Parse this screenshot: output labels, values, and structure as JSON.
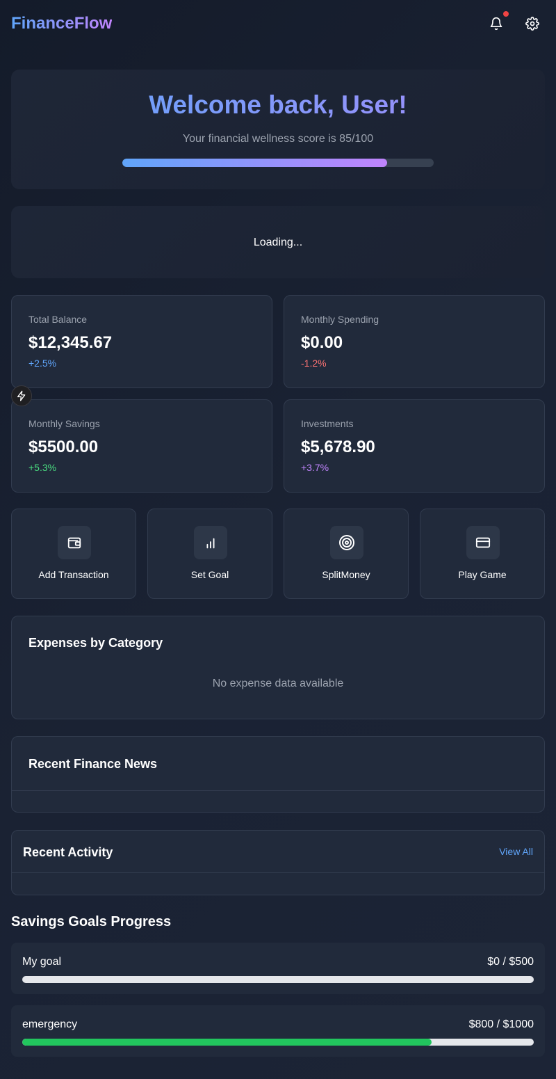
{
  "header": {
    "logo": "FinanceFlow",
    "icons": [
      "bell-icon",
      "gear-icon"
    ],
    "notification_dot_color": "#ef4444"
  },
  "welcome": {
    "title": "Welcome back, User!",
    "subtitle": "Your financial wellness score is 85/100",
    "score": 85,
    "score_max": 100
  },
  "loading": {
    "text": "Loading..."
  },
  "stats": [
    {
      "label": "Total Balance",
      "value": "$12,345.67",
      "change": "+2.5%",
      "change_color": "#60a5fa"
    },
    {
      "label": "Monthly Spending",
      "value": "$0.00",
      "change": "-1.2%",
      "change_color": "#f87171"
    },
    {
      "label": "Monthly Savings",
      "value": "$5500.00",
      "change": "+5.3%",
      "change_color": "#4ade80"
    },
    {
      "label": "Investments",
      "value": "$5,678.90",
      "change": "+3.7%",
      "change_color": "#c084fc"
    }
  ],
  "actions": [
    {
      "label": "Add Transaction",
      "icon": "wallet-icon"
    },
    {
      "label": "Set Goal",
      "icon": "bar-chart-icon"
    },
    {
      "label": "SplitMoney",
      "icon": "target-icon"
    },
    {
      "label": "Play Game",
      "icon": "credit-card-icon"
    }
  ],
  "expenses": {
    "title": "Expenses by Category",
    "empty_text": "No expense data available"
  },
  "news": {
    "title": "Recent Finance News"
  },
  "activity": {
    "title": "Recent Activity",
    "view_all": "View All"
  },
  "savings": {
    "title": "Savings Goals Progress",
    "goals": [
      {
        "name": "My goal",
        "amount": "$0 / $500",
        "progress": 0
      },
      {
        "name": "emergency",
        "amount": "$800 / $1000",
        "progress": 0.8
      }
    ],
    "fill_color": "#22c55e"
  }
}
